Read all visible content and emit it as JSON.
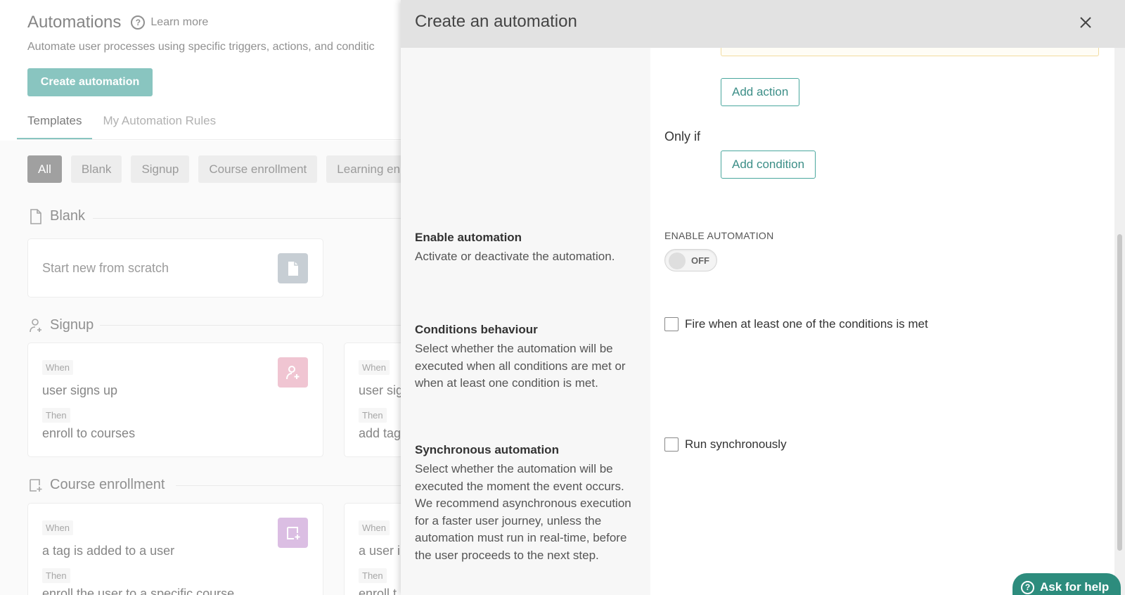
{
  "page": {
    "title": "Automations",
    "learn_more": "Learn more",
    "subtitle": "Automate user processes using specific triggers, actions, and conditic",
    "create_button": "Create automation",
    "tabs": [
      {
        "label": "Templates",
        "active": true
      },
      {
        "label": "My Automation Rules",
        "active": false
      }
    ],
    "filters": [
      {
        "label": "All",
        "active": true
      },
      {
        "label": "Blank"
      },
      {
        "label": "Signup"
      },
      {
        "label": "Course enrollment"
      },
      {
        "label": "Learning en"
      }
    ],
    "sections": {
      "blank": {
        "title": "Blank",
        "card_text": "Start new from scratch"
      },
      "signup": {
        "title": "Signup",
        "cards": [
          {
            "when_label": "When",
            "when": "user signs up",
            "then_label": "Then",
            "then": "enroll to courses"
          },
          {
            "when_label": "When",
            "when": "user sig",
            "then_label": "Then",
            "then": "add tag"
          }
        ]
      },
      "course_enrollment": {
        "title": "Course enrollment",
        "cards": [
          {
            "when_label": "When",
            "when": "a tag is added to a user",
            "then_label": "Then",
            "then": "enroll the user to a specific course"
          },
          {
            "when_label": "When",
            "when": "a user i",
            "then_label": "Then",
            "then": "enroll t"
          }
        ]
      }
    }
  },
  "drawer": {
    "title": "Create an automation",
    "add_action": "Add action",
    "only_if": "Only if",
    "add_condition": "Add condition",
    "enable": {
      "label": "Enable automation",
      "desc": "Activate or deactivate the automation.",
      "caption": "ENABLE AUTOMATION",
      "toggle_state": "OFF"
    },
    "conditions": {
      "label": "Conditions behaviour",
      "desc": "Select whether the automation will be executed when all conditions are met or when at least one condition is met.",
      "checkbox": "Fire when at least one of the conditions is met"
    },
    "synchronous": {
      "label": "Synchronous automation",
      "desc": "Select whether the automation will be executed the moment the event occurs. We recommend asynchronous execution for a faster user journey, unless the automation must run in real-time, before the user proceeds to the next step.",
      "checkbox": "Run synchronously"
    }
  },
  "help_widget": {
    "label": "Ask for help"
  },
  "colors": {
    "accent": "#4aa79e",
    "signup_icon": "#e9a7bb",
    "course_icon": "#c89cd4",
    "blank_icon": "#aab4bd",
    "header_gray": "#e2e2e2"
  }
}
